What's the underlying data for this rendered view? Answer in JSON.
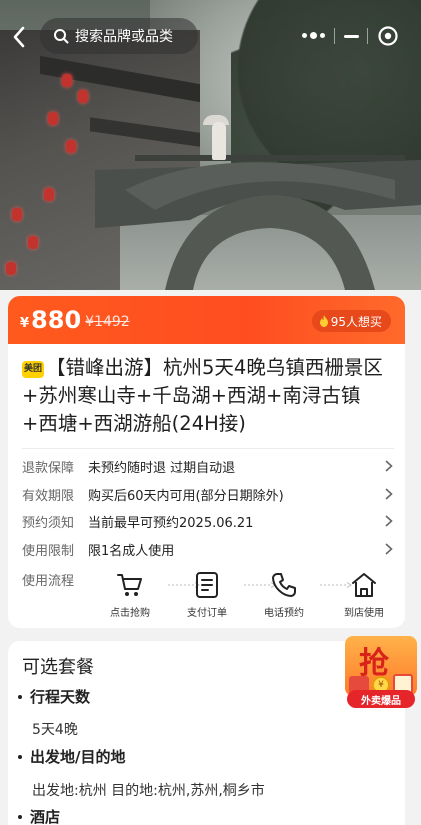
{
  "header": {
    "search_placeholder": "搜索品牌或品类",
    "icons": [
      "back-arrow-icon",
      "search-icon",
      "more-dots-icon",
      "minimize-icon",
      "target-icon"
    ]
  },
  "price": {
    "currency": "¥",
    "current": "880",
    "original": "¥1492",
    "want_text": "95人想买"
  },
  "product": {
    "brand_badge": "美团",
    "title": "【错峰出游】杭州5天4晚乌镇西栅景区+苏州寒山寺+千岛湖+西湖+南浔古镇+西塘+西湖游船(24H接)"
  },
  "info": [
    {
      "label": "退款保障",
      "value": "未预约随时退 过期自动退"
    },
    {
      "label": "有效期限",
      "value": "购买后60天内可用(部分日期除外)"
    },
    {
      "label": "预约须知",
      "value": "当前最早可预约2025.06.21"
    },
    {
      "label": "使用限制",
      "value": "限1名成人使用"
    }
  ],
  "flow": {
    "label": "使用流程",
    "steps": [
      {
        "label": "点击抢购",
        "icon": "cart-icon"
      },
      {
        "label": "支付订单",
        "icon": "order-icon"
      },
      {
        "label": "电话预约",
        "icon": "phone-icon"
      },
      {
        "label": "到店使用",
        "icon": "store-icon"
      }
    ]
  },
  "package": {
    "title": "可选套餐",
    "sections": [
      {
        "label": "行程天数",
        "value": "5天4晚"
      },
      {
        "label": "出发地/目的地",
        "value": "出发地:杭州 目的地:杭州,苏州,桐乡市"
      },
      {
        "label": "酒店",
        "value": ""
      }
    ]
  },
  "promo": {
    "big_char": "抢",
    "tag": "外卖爆品",
    "coin": "¥"
  },
  "colors": {
    "accent": "#ff5a1e",
    "brand_yellow": "#ffd100"
  }
}
